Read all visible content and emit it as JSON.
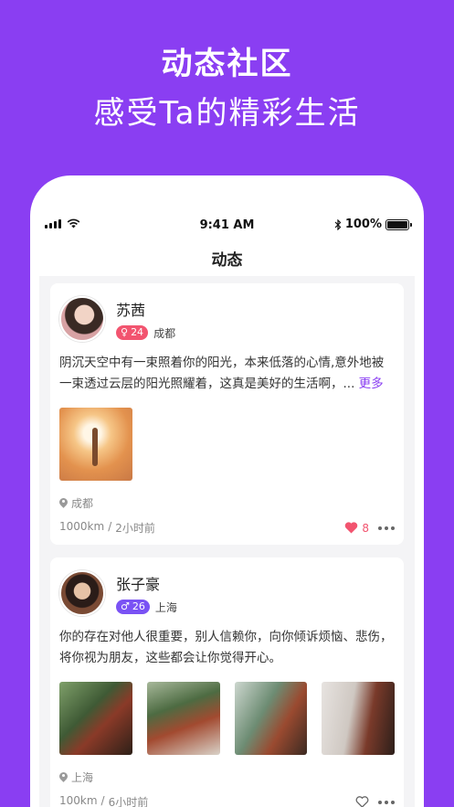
{
  "hero": {
    "title": "动态社区",
    "subtitle": "感受Ta的精彩生活"
  },
  "status_bar": {
    "time": "9:41 AM",
    "battery": "100%"
  },
  "nav": {
    "title": "动态"
  },
  "posts": [
    {
      "name": "苏茜",
      "gender": "female",
      "gender_symbol": "♀",
      "age": "24",
      "city": "成都",
      "text": "阴沉天空中有一束照着你的阳光，本来低落的心情,意外地被一束透过云层的阳光照耀着，这真是美好的生活啊，... ",
      "more_label": "更多",
      "location": "成都",
      "distance": "1000km",
      "separator": "/",
      "time_ago": "2小时前",
      "likes": "8",
      "liked": true
    },
    {
      "name": "张子豪",
      "gender": "male",
      "gender_symbol": "♂",
      "age": "26",
      "city": "上海",
      "text": "你的存在对他人很重要，别人信赖你，向你倾诉烦恼、悲伤，将你视为朋友，这些都会让你觉得开心。",
      "location": "上海",
      "distance": "100km",
      "separator": "/",
      "time_ago": "6小时前",
      "liked": false
    }
  ],
  "colors": {
    "background": "#8a3ef2",
    "accent": "#8a3ef2",
    "female_badge": "#f2546f",
    "male_badge": "#7a52f4",
    "like": "#f2546f"
  }
}
